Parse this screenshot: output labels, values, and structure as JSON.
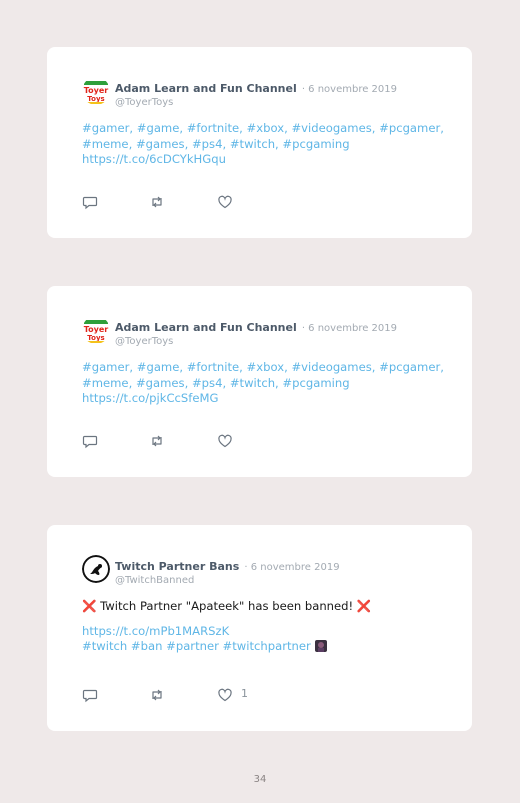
{
  "tweets": [
    {
      "name": "Adam Learn and Fun Channel",
      "date": "· 6 novembre 2019",
      "handle": "@ToyerToys",
      "lines": [
        "#gamer, #game, #fortnite, #xbox, #videogames, #pcgamer,",
        "#meme, #games, #ps4, #twitch, #pcgaming",
        "https://t.co/6cDCYkHGqu"
      ],
      "avatar_text": [
        "Toyer",
        "Toys"
      ]
    },
    {
      "name": "Adam Learn and Fun Channel",
      "date": "· 6 novembre 2019",
      "handle": "@ToyerToys",
      "lines": [
        "#gamer, #game, #fortnite, #xbox, #videogames, #pcgamer,",
        "#meme, #games, #ps4, #twitch, #pcgaming",
        "https://t.co/pjkCcSfeMG"
      ],
      "avatar_text": [
        "Toyer",
        "Toys"
      ]
    },
    {
      "name": "Twitch Partner Bans",
      "date": "· 6 novembre 2019",
      "handle": "@TwitchBanned",
      "headline_cross": "❌",
      "headline": "Twitch Partner \"Apateek\" has been banned!",
      "link": "https://t.co/mPb1MARSzK",
      "tags": "#twitch #ban #partner #twitchpartner",
      "like_count": "1"
    }
  ],
  "icons": {
    "reply": "reply-icon",
    "retweet": "retweet-icon",
    "like": "heart-icon"
  },
  "colors": {
    "background": "#efe9e9",
    "link": "#5fb6e6",
    "name": "#4d5a69",
    "muted": "#a3aab2",
    "cross": "#d92020"
  },
  "page_number": "34"
}
